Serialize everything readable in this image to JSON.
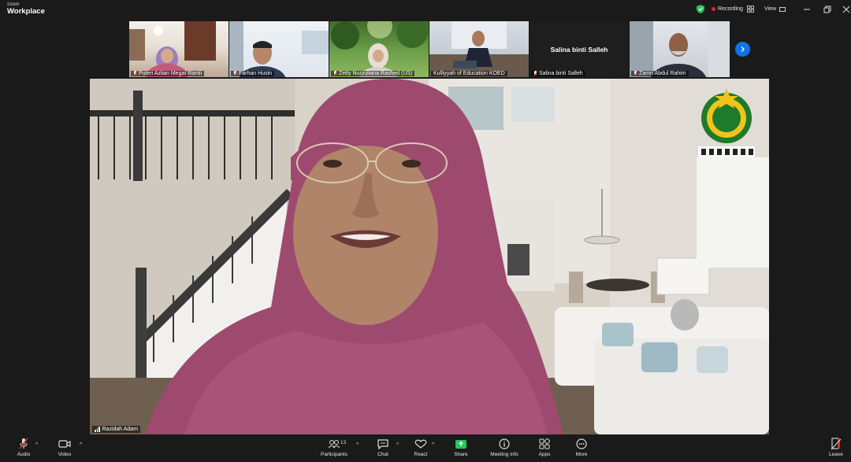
{
  "app": {
    "brand_small": "zoom",
    "brand_name": "Workplace"
  },
  "titlebar": {
    "recording_label": "Recording",
    "view_label": "View",
    "colors": {
      "recording_dot": "#e02828",
      "shield": "#22c55e"
    }
  },
  "gallery": {
    "tiles": [
      {
        "name": "Puteri Azlian Megat Ramli",
        "muted": true,
        "video": true
      },
      {
        "name": "Farhan Husin",
        "muted": true,
        "video": true
      },
      {
        "name": "Zetty Nurzuliana Rashed (US)",
        "muted": true,
        "video": true
      },
      {
        "name": "Kulliyyah of Education KOED",
        "muted": false,
        "video": true
      },
      {
        "name": "Salina binti Salleh",
        "muted": true,
        "video": false,
        "display_name": "Salina binti Salleh"
      },
      {
        "name": "Zamri Abdul Rahim",
        "muted": true,
        "video": true
      }
    ],
    "next_icon": "chevron-right-icon"
  },
  "speaker": {
    "name": "Razidah Adam"
  },
  "toolbar": {
    "audio_label": "Audio",
    "video_label": "Video",
    "participants_label": "Participants",
    "participants_count": "13",
    "chat_label": "Chat",
    "react_label": "React",
    "share_label": "Share",
    "meeting_info_label": "Meeting info",
    "apps_label": "Apps",
    "more_label": "More",
    "leave_label": "Leave",
    "colors": {
      "share": "#22c55e",
      "leave": "#e02828"
    }
  }
}
